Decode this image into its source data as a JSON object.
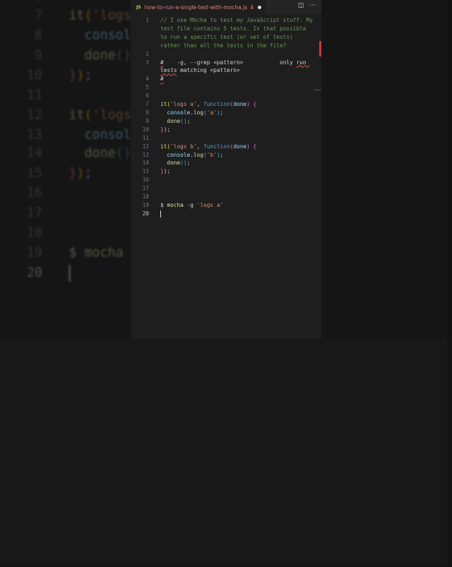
{
  "tab": {
    "lang_badge": "JS",
    "filename": "how-to-run-a-single-test-with-mocha.js",
    "problems": "4"
  },
  "actions": {
    "split": "◫",
    "more": "···"
  },
  "active_line": 20,
  "lines": [
    {
      "n": "1",
      "tokens": [
        {
          "t": "// I use Mocha to test my JavaScript stuff. My test file contains 5 tests. Is that possible to run a specific test (or set of tests) rather than all the tests in the file?",
          "c": "comment"
        }
      ]
    },
    {
      "n": "2",
      "tokens": []
    },
    {
      "n": "3",
      "tokens": [
        {
          "t": "#",
          "c": "squig"
        },
        {
          "t": "    -g, --grep <pattern>           only ",
          "c": "plain"
        },
        {
          "t": "run tests",
          "c": "squig"
        },
        {
          "t": " matching <pattern>",
          "c": "plain"
        }
      ]
    },
    {
      "n": "4",
      "tokens": [
        {
          "t": "#",
          "c": "squig"
        }
      ]
    },
    {
      "n": "5",
      "tokens": []
    },
    {
      "n": "6",
      "tokens": []
    },
    {
      "n": "7",
      "tokens": [
        {
          "t": "it",
          "c": "fn"
        },
        {
          "t": "(",
          "c": "paren"
        },
        {
          "t": "'logs a'",
          "c": "str"
        },
        {
          "t": ", ",
          "c": "plain"
        },
        {
          "t": "function",
          "c": "kw"
        },
        {
          "t": "(",
          "c": "brace"
        },
        {
          "t": "done",
          "c": "par"
        },
        {
          "t": ") ",
          "c": "brace"
        },
        {
          "t": "{",
          "c": "brace"
        }
      ]
    },
    {
      "n": "8",
      "tokens": [
        {
          "t": "  console",
          "c": "par"
        },
        {
          "t": ".",
          "c": "plain"
        },
        {
          "t": "log",
          "c": "fn"
        },
        {
          "t": "(",
          "c": "kw"
        },
        {
          "t": "'a'",
          "c": "str"
        },
        {
          "t": ")",
          "c": "kw"
        },
        {
          "t": ";",
          "c": "plain"
        }
      ]
    },
    {
      "n": "9",
      "tokens": [
        {
          "t": "  done",
          "c": "fn"
        },
        {
          "t": "()",
          "c": "kw"
        },
        {
          "t": ";",
          "c": "plain"
        }
      ]
    },
    {
      "n": "10",
      "tokens": [
        {
          "t": "}",
          "c": "brace"
        },
        {
          "t": ")",
          "c": "paren"
        },
        {
          "t": ";",
          "c": "plain"
        }
      ]
    },
    {
      "n": "11",
      "tokens": []
    },
    {
      "n": "12",
      "tokens": [
        {
          "t": "it",
          "c": "fn"
        },
        {
          "t": "(",
          "c": "paren"
        },
        {
          "t": "'logs b'",
          "c": "str"
        },
        {
          "t": ", ",
          "c": "plain"
        },
        {
          "t": "function",
          "c": "kw"
        },
        {
          "t": "(",
          "c": "brace"
        },
        {
          "t": "done",
          "c": "par"
        },
        {
          "t": ") ",
          "c": "brace"
        },
        {
          "t": "{",
          "c": "brace"
        }
      ]
    },
    {
      "n": "13",
      "tokens": [
        {
          "t": "  console",
          "c": "par"
        },
        {
          "t": ".",
          "c": "plain"
        },
        {
          "t": "log",
          "c": "fn"
        },
        {
          "t": "(",
          "c": "kw"
        },
        {
          "t": "'b'",
          "c": "str"
        },
        {
          "t": ")",
          "c": "kw"
        },
        {
          "t": ";",
          "c": "plain"
        }
      ]
    },
    {
      "n": "14",
      "tokens": [
        {
          "t": "  done",
          "c": "fn"
        },
        {
          "t": "()",
          "c": "kw"
        },
        {
          "t": ";",
          "c": "plain"
        }
      ]
    },
    {
      "n": "15",
      "tokens": [
        {
          "t": "}",
          "c": "brace"
        },
        {
          "t": ")",
          "c": "paren"
        },
        {
          "t": ";",
          "c": "plain"
        }
      ]
    },
    {
      "n": "16",
      "tokens": []
    },
    {
      "n": "17",
      "tokens": []
    },
    {
      "n": "18",
      "tokens": []
    },
    {
      "n": "19",
      "tokens": [
        {
          "t": "$ ",
          "c": "plain"
        },
        {
          "t": "mocha",
          "c": "fn"
        },
        {
          "t": " -g ",
          "c": "plain"
        },
        {
          "t": "'logs a'",
          "c": "str"
        }
      ]
    },
    {
      "n": "20",
      "tokens": []
    }
  ]
}
